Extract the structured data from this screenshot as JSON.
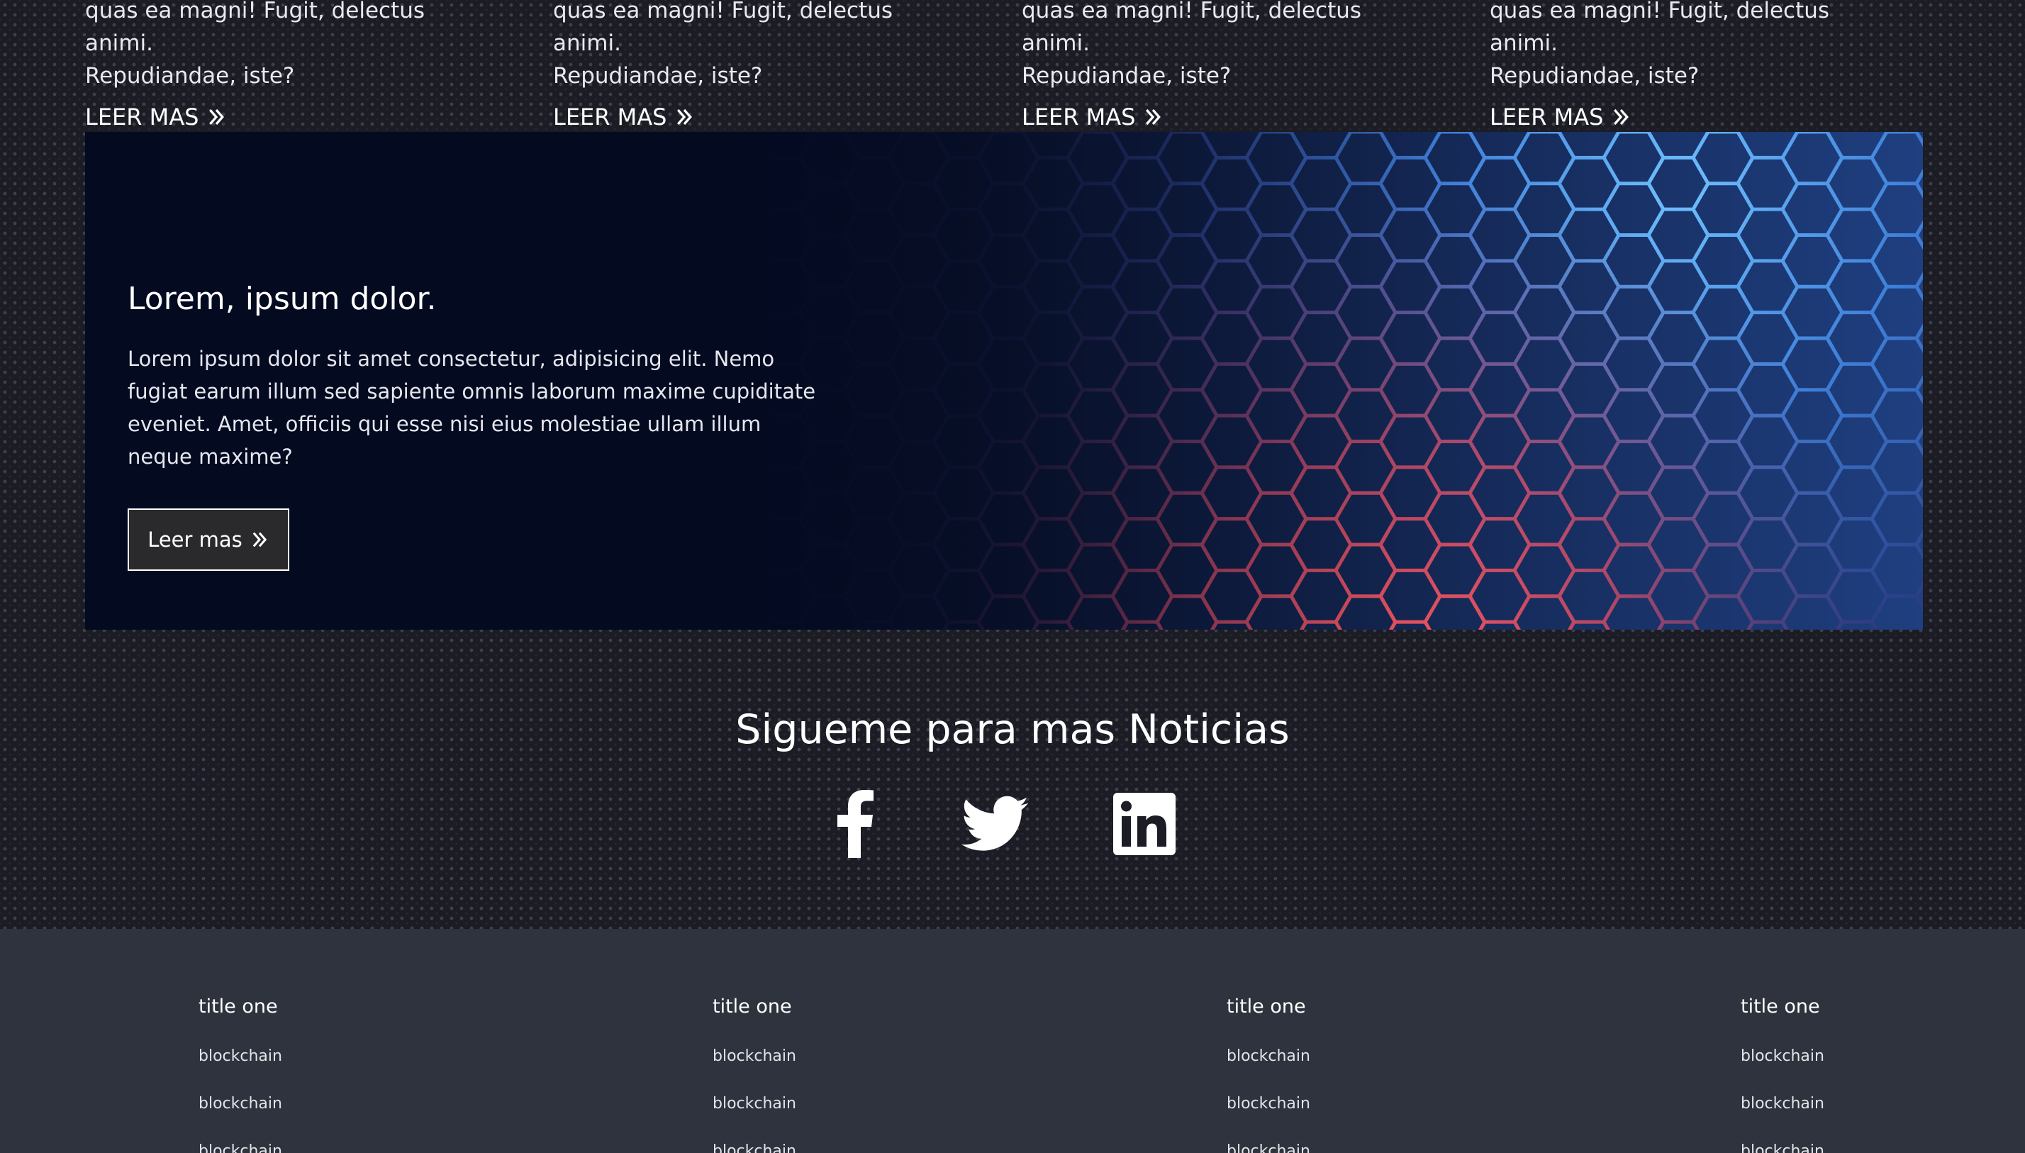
{
  "cards": [
    {
      "text_line1": "quas ea magni! Fugit, delectus animi.",
      "text_line2": "Repudiandae, iste?",
      "link_label": "LEER MAS"
    },
    {
      "text_line1": "quas ea magni! Fugit, delectus animi.",
      "text_line2": "Repudiandae, iste?",
      "link_label": "LEER MAS"
    },
    {
      "text_line1": "quas ea magni! Fugit, delectus animi.",
      "text_line2": "Repudiandae, iste?",
      "link_label": "LEER MAS"
    },
    {
      "text_line1": "quas ea magni! Fugit, delectus animi.",
      "text_line2": "Repudiandae, iste?",
      "link_label": "LEER MAS"
    }
  ],
  "banner": {
    "title": "Lorem, ipsum dolor.",
    "text": "Lorem ipsum dolor sit amet consectetur, adipisicing elit. Nemo fugiat earum illum sed sapiente omnis laborum maxime cupiditate eveniet. Amet, officiis qui esse nisi eius molestiae ullam illum neque maxime?",
    "button_label": "Leer mas"
  },
  "follow": {
    "title": "Sigueme para mas Noticias",
    "icons": [
      "facebook-icon",
      "twitter-icon",
      "linkedin-icon"
    ]
  },
  "footer": {
    "columns": [
      {
        "title": "title one",
        "links": [
          "blockchain",
          "blockchain",
          "blockchain"
        ]
      },
      {
        "title": "title one",
        "links": [
          "blockchain",
          "blockchain",
          "blockchain"
        ]
      },
      {
        "title": "title one",
        "links": [
          "blockchain",
          "blockchain",
          "blockchain"
        ]
      },
      {
        "title": "title one",
        "links": [
          "blockchain",
          "blockchain",
          "blockchain"
        ]
      }
    ]
  },
  "colors": {
    "page_background": "#1b1c24",
    "banner_background": "#040a20",
    "hex_blue": "#4a9cf0",
    "hex_red": "#f0505a",
    "footer_background": "#2e333d",
    "text": "#ffffff"
  }
}
